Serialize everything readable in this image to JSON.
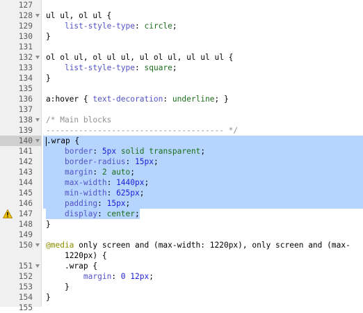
{
  "lines": [
    {
      "num": "127",
      "fold": false,
      "tokens": []
    },
    {
      "num": "128",
      "fold": true,
      "tokens": [
        {
          "t": "ul ul, ol ul {",
          "c": "k"
        }
      ]
    },
    {
      "num": "129",
      "fold": false,
      "tokens": [
        {
          "t": "    ",
          "c": "k"
        },
        {
          "t": "list-style-type",
          "c": "p"
        },
        {
          "t": ": ",
          "c": "k"
        },
        {
          "t": "circle",
          "c": "v"
        },
        {
          "t": ";",
          "c": "k"
        }
      ]
    },
    {
      "num": "130",
      "fold": false,
      "tokens": [
        {
          "t": "}",
          "c": "k"
        }
      ]
    },
    {
      "num": "131",
      "fold": false,
      "tokens": []
    },
    {
      "num": "132",
      "fold": true,
      "tokens": [
        {
          "t": "ol ol ul, ol ul ul, ul ol ul, ul ul ul {",
          "c": "k"
        }
      ]
    },
    {
      "num": "133",
      "fold": false,
      "tokens": [
        {
          "t": "    ",
          "c": "k"
        },
        {
          "t": "list-style-type",
          "c": "p"
        },
        {
          "t": ": ",
          "c": "k"
        },
        {
          "t": "square",
          "c": "v"
        },
        {
          "t": ";",
          "c": "k"
        }
      ]
    },
    {
      "num": "134",
      "fold": false,
      "tokens": [
        {
          "t": "}",
          "c": "k"
        }
      ]
    },
    {
      "num": "135",
      "fold": false,
      "tokens": []
    },
    {
      "num": "136",
      "fold": false,
      "tokens": [
        {
          "t": "a:hover { ",
          "c": "k"
        },
        {
          "t": "text-decoration",
          "c": "p"
        },
        {
          "t": ": ",
          "c": "k"
        },
        {
          "t": "underline",
          "c": "v"
        },
        {
          "t": "; }",
          "c": "k"
        }
      ]
    },
    {
      "num": "137",
      "fold": false,
      "tokens": []
    },
    {
      "num": "138",
      "fold": true,
      "tokens": [
        {
          "t": "/* Main blocks",
          "c": "cm"
        }
      ]
    },
    {
      "num": "139",
      "fold": false,
      "tokens": [
        {
          "t": "-------------------------------------- */",
          "c": "cm"
        }
      ]
    },
    {
      "num": "140",
      "fold": true,
      "sel": true,
      "tokens": [
        {
          "t": ".wrap {",
          "c": "k"
        }
      ]
    },
    {
      "num": "141",
      "fold": false,
      "sel": true,
      "tokens": [
        {
          "t": "    ",
          "c": "k"
        },
        {
          "t": "border",
          "c": "p"
        },
        {
          "t": ": ",
          "c": "k"
        },
        {
          "t": "5px",
          "c": "num"
        },
        {
          "t": " ",
          "c": "k"
        },
        {
          "t": "solid transparent",
          "c": "v"
        },
        {
          "t": ";",
          "c": "k"
        }
      ]
    },
    {
      "num": "142",
      "fold": false,
      "sel": true,
      "tokens": [
        {
          "t": "    ",
          "c": "k"
        },
        {
          "t": "border-radius",
          "c": "p"
        },
        {
          "t": ": ",
          "c": "k"
        },
        {
          "t": "15px",
          "c": "num"
        },
        {
          "t": ";",
          "c": "k"
        }
      ]
    },
    {
      "num": "143",
      "fold": false,
      "sel": true,
      "tokens": [
        {
          "t": "    ",
          "c": "k"
        },
        {
          "t": "margin",
          "c": "p"
        },
        {
          "t": ": ",
          "c": "k"
        },
        {
          "t": "2 auto",
          "c": "v"
        },
        {
          "t": ";",
          "c": "k"
        }
      ]
    },
    {
      "num": "144",
      "fold": false,
      "sel": true,
      "tokens": [
        {
          "t": "    ",
          "c": "k"
        },
        {
          "t": "max-width",
          "c": "p"
        },
        {
          "t": ": ",
          "c": "k"
        },
        {
          "t": "1440px",
          "c": "num"
        },
        {
          "t": ";",
          "c": "k"
        }
      ]
    },
    {
      "num": "145",
      "fold": false,
      "sel": true,
      "tokens": [
        {
          "t": "    ",
          "c": "k"
        },
        {
          "t": "min-width",
          "c": "p"
        },
        {
          "t": ": ",
          "c": "k"
        },
        {
          "t": "625px",
          "c": "num"
        },
        {
          "t": ";",
          "c": "k"
        }
      ]
    },
    {
      "num": "146",
      "fold": false,
      "sel": true,
      "tokens": [
        {
          "t": "    ",
          "c": "k"
        },
        {
          "t": "padding",
          "c": "p"
        },
        {
          "t": ": ",
          "c": "k"
        },
        {
          "t": "15px",
          "c": "num"
        },
        {
          "t": ";",
          "c": "k"
        }
      ]
    },
    {
      "num": "147",
      "fold": false,
      "warn": true,
      "sel": "partial",
      "tokens": [
        {
          "t": "    ",
          "c": "k"
        },
        {
          "t": "display",
          "c": "p"
        },
        {
          "t": ": ",
          "c": "k"
        },
        {
          "t": "center",
          "c": "v"
        },
        {
          "t": ";",
          "c": "k"
        }
      ]
    },
    {
      "num": "148",
      "fold": false,
      "tokens": [
        {
          "t": "}",
          "c": "k"
        }
      ]
    },
    {
      "num": "149",
      "fold": false,
      "tokens": []
    },
    {
      "num": "150",
      "fold": true,
      "tokens": [
        {
          "t": "@media",
          "c": "at"
        },
        {
          "t": " only screen and (max-width: 1220px), only screen and (max-",
          "c": "k"
        }
      ]
    },
    {
      "num": "",
      "fold": false,
      "cont": true,
      "tokens": [
        {
          "t": "1220px) {",
          "c": "k"
        }
      ]
    },
    {
      "num": "151",
      "fold": true,
      "tokens": [
        {
          "t": "    ",
          "c": "k"
        },
        {
          "t": ".wrap {",
          "c": "k"
        }
      ]
    },
    {
      "num": "152",
      "fold": false,
      "tokens": [
        {
          "t": "        ",
          "c": "k"
        },
        {
          "t": "margin",
          "c": "p"
        },
        {
          "t": ": ",
          "c": "k"
        },
        {
          "t": "0 12px",
          "c": "num"
        },
        {
          "t": ";",
          "c": "k"
        }
      ]
    },
    {
      "num": "153",
      "fold": false,
      "tokens": [
        {
          "t": "    }",
          "c": "k"
        }
      ]
    },
    {
      "num": "154",
      "fold": false,
      "tokens": [
        {
          "t": "}",
          "c": "k"
        }
      ]
    },
    {
      "num": "155",
      "fold": false,
      "tokens": []
    }
  ],
  "colors": {
    "selection": "#b5d5ff",
    "gutter": "#f0f0f0",
    "warning": "#f0c000"
  }
}
